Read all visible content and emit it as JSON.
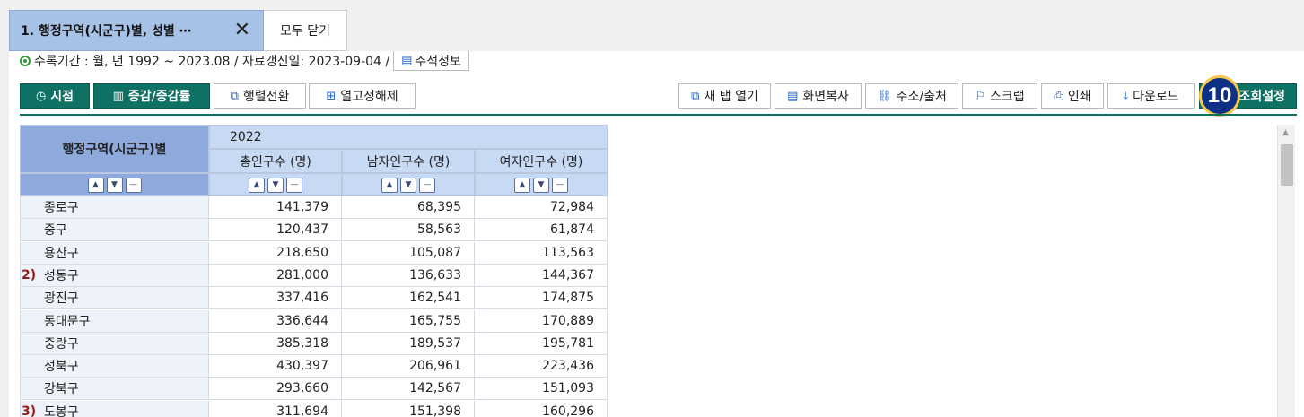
{
  "tabs": {
    "active_label": "1. 행정구역(시군구)별, 성별 ⋯",
    "close_all_label": "모두 닫기"
  },
  "period": {
    "text": "수록기간 : 월, 년 1992 ~ 2023.08 / 자료갱신일: 2023-09-04 /",
    "note_label": "주석정보"
  },
  "toolbar": {
    "left": [
      {
        "label": "시점",
        "icon": "clock-icon",
        "glyph": "◷"
      },
      {
        "label": "증감/증감률",
        "icon": "chart-icon",
        "glyph": "▥"
      },
      {
        "label": "행렬전환",
        "icon": "pivot-icon",
        "glyph": "⧉"
      },
      {
        "label": "열고정해제",
        "icon": "unpin-icon",
        "glyph": "⊞"
      }
    ],
    "right": [
      {
        "label": "새 탭 열기",
        "icon": "new-tab-icon",
        "glyph": "⧉"
      },
      {
        "label": "화면복사",
        "icon": "copy-icon",
        "glyph": "▤"
      },
      {
        "label": "주소/출처",
        "icon": "link-icon",
        "glyph": "⛓"
      },
      {
        "label": "스크랩",
        "icon": "bookmark-icon",
        "glyph": "⚐"
      },
      {
        "label": "인쇄",
        "icon": "print-icon",
        "glyph": "⎙"
      },
      {
        "label": "다운로드",
        "icon": "download-icon",
        "glyph": "⤓"
      },
      {
        "label": "조회설정",
        "icon": "settings-icon",
        "glyph": ""
      }
    ],
    "step_badge": "10"
  },
  "table": {
    "row_header": "행정구역(시군구)별",
    "year": "2022",
    "columns": [
      "총인구수 (명)",
      "남자인구수 (명)",
      "여자인구수 (명)"
    ],
    "rows": [
      {
        "name": "종로구",
        "fn": "",
        "values": [
          "141,379",
          "68,395",
          "72,984"
        ]
      },
      {
        "name": "중구",
        "fn": "",
        "values": [
          "120,437",
          "58,563",
          "61,874"
        ]
      },
      {
        "name": "용산구",
        "fn": "",
        "values": [
          "218,650",
          "105,087",
          "113,563"
        ]
      },
      {
        "name": "성동구",
        "fn": "2)",
        "values": [
          "281,000",
          "136,633",
          "144,367"
        ]
      },
      {
        "name": "광진구",
        "fn": "",
        "values": [
          "337,416",
          "162,541",
          "174,875"
        ]
      },
      {
        "name": "동대문구",
        "fn": "",
        "values": [
          "336,644",
          "165,755",
          "170,889"
        ]
      },
      {
        "name": "중랑구",
        "fn": "",
        "values": [
          "385,318",
          "189,537",
          "195,781"
        ]
      },
      {
        "name": "성북구",
        "fn": "",
        "values": [
          "430,397",
          "206,961",
          "223,436"
        ]
      },
      {
        "name": "강북구",
        "fn": "",
        "values": [
          "293,660",
          "142,567",
          "151,093"
        ]
      },
      {
        "name": "도봉구",
        "fn": "3)",
        "values": [
          "311,694",
          "151,398",
          "160,296"
        ]
      }
    ]
  },
  "colors": {
    "accent": "#0f7064",
    "tab_active": "#a6c2e6",
    "header_bg": "#8ea9dc",
    "subheader_bg": "#c8d9f4"
  }
}
